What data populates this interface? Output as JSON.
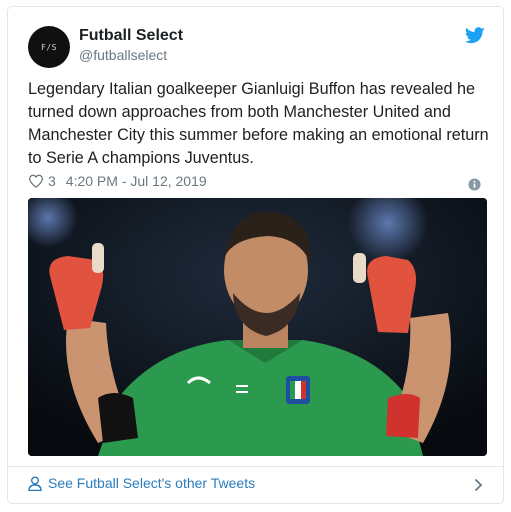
{
  "author": {
    "name": "Futball Select",
    "handle": "@futballselect",
    "avatar_mark": "F/S"
  },
  "tweet": {
    "text": "Legendary Italian goalkeeper Gianluigi Buffon has revealed he turned down approaches from both Manchester United and Manchester City this summer before making an emotional return to Serie A champions Juventus.",
    "likes": "3",
    "timestamp": "4:20 PM - Jul 12, 2019"
  },
  "footer": {
    "link_label": "See Futball Select's other Tweets"
  },
  "icons": {
    "brand": "twitter-bird-icon",
    "like": "heart-icon",
    "info": "info-icon",
    "profile": "person-icon",
    "next": "chevron-right-icon"
  },
  "colors": {
    "twitter_blue": "#1da1f2",
    "link_blue": "#2b7bb9",
    "muted": "#697882",
    "border": "#e1e8ed"
  }
}
